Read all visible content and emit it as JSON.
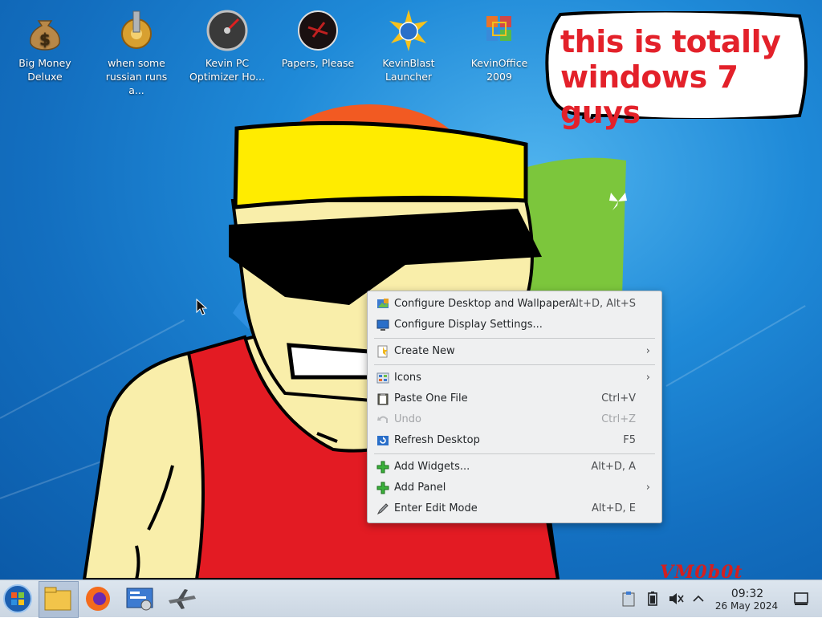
{
  "desktop_icons": [
    {
      "label": "Big Money\nDeluxe",
      "icon": "money-bag-icon"
    },
    {
      "label": "when some\nrussian runs a...",
      "icon": "gear-icon"
    },
    {
      "label": "Kevin PC\nOptimizer Ho...",
      "icon": "speedometer-icon"
    },
    {
      "label": "Papers, Please",
      "icon": "papers-please-icon"
    },
    {
      "label": "KevinBlast\nLauncher",
      "icon": "starburst-globe-icon"
    },
    {
      "label": "KevinOffice\n2009",
      "icon": "office-logo-icon"
    }
  ],
  "speech_bubble": {
    "text": "this is totally windows 7 guys"
  },
  "watermark": "VM0b0t",
  "context_menu": {
    "items": [
      {
        "label": "Configure Desktop and Wallpaper...",
        "shortcut": "Alt+D, Alt+S",
        "icon": "configure-desktop-icon"
      },
      {
        "label": "Configure Display Settings...",
        "shortcut": "",
        "icon": "display-icon"
      },
      {
        "label": "Create New",
        "shortcut": "",
        "icon": "new-file-icon",
        "submenu": true
      },
      {
        "label": "Icons",
        "shortcut": "",
        "icon": "icons-grid-icon",
        "submenu": true
      },
      {
        "label": "Paste One File",
        "shortcut": "Ctrl+V",
        "icon": "paste-icon"
      },
      {
        "label": "Undo",
        "shortcut": "Ctrl+Z",
        "icon": "undo-icon",
        "disabled": true
      },
      {
        "label": "Refresh Desktop",
        "shortcut": "F5",
        "icon": "refresh-icon"
      },
      {
        "label": "Add Widgets...",
        "shortcut": "Alt+D, A",
        "icon": "add-icon"
      },
      {
        "label": "Add Panel",
        "shortcut": "",
        "icon": "add-icon",
        "submenu": true
      },
      {
        "label": "Enter Edit Mode",
        "shortcut": "Alt+D, E",
        "icon": "edit-mode-icon"
      }
    ],
    "submenu_arrow": "›"
  },
  "taskbar": {
    "start": "start-orb-icon",
    "apps": [
      "file-manager-icon",
      "firefox-icon",
      "system-settings-icon",
      "airplane-app-icon"
    ],
    "tray": [
      "clipboard-icon",
      "battery-icon",
      "volume-muted-icon",
      "tray-expand-icon"
    ],
    "clock_time": "09:32",
    "clock_date": "26 May 2024",
    "show_desktop": "show-desktop-icon"
  },
  "colors": {
    "menu_bg": "#eff0f1",
    "bubble_text": "#e3212a",
    "desktop": "#1f8ad8",
    "taskbar": "#d3dde8"
  }
}
